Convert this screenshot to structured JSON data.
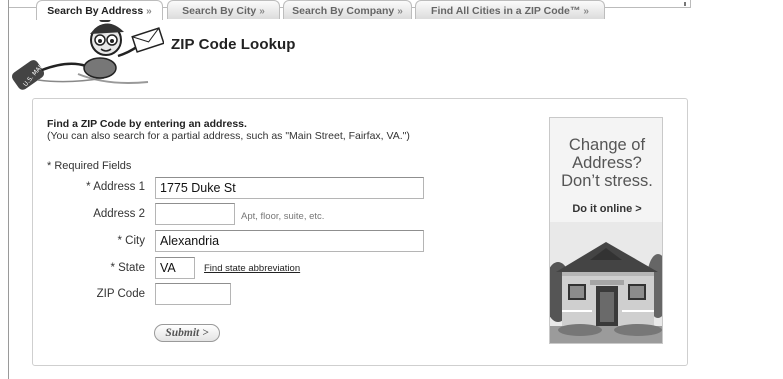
{
  "page": {
    "title": "ZIP Code Lookup"
  },
  "tabs": [
    {
      "label": "Search By Address",
      "chevron": "»",
      "active": true
    },
    {
      "label": "Search By City",
      "chevron": "»",
      "active": false
    },
    {
      "label": "Search By Company",
      "chevron": "»",
      "active": false
    },
    {
      "label": "Find All Cities in a ZIP Code™",
      "chevron": "»",
      "active": false
    }
  ],
  "intro": {
    "title": "Find a ZIP Code by entering an address.",
    "subtitle": "(You can also search for a partial address, such as \"Main Street, Fairfax, VA.\")"
  },
  "form": {
    "required_note": "* Required Fields",
    "address1": {
      "label": "* Address 1",
      "value": "1775 Duke St"
    },
    "address2": {
      "label": "Address 2",
      "value": "",
      "hint": "Apt, floor, suite, etc."
    },
    "city": {
      "label": "* City",
      "value": "Alexandria"
    },
    "state": {
      "label": "* State",
      "value": "VA",
      "link": "Find state abbreviation"
    },
    "zip": {
      "label": "ZIP Code",
      "value": ""
    },
    "submit_label": "Submit >"
  },
  "ad": {
    "line1": "Change of",
    "line2": "Address?",
    "line3": "Don’t stress.",
    "cta": "Do it online >"
  },
  "logo": {
    "bag_text": "U.S. MAIL"
  },
  "icons": [
    "mr-zip-mascot-icon",
    "house-illustration-icon"
  ]
}
